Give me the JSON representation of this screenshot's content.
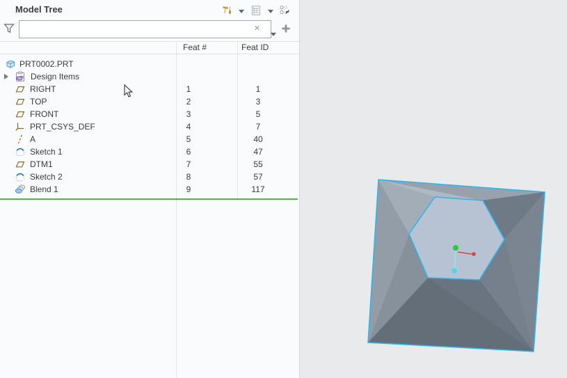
{
  "panel": {
    "title": "Model Tree",
    "toolbar_icons": [
      "tools-icon",
      "dropdown-arrow",
      "tree-settings-icon",
      "dropdown-arrow",
      "show-hide-tree-items-icon"
    ]
  },
  "filter": {
    "value": "",
    "placeholder": "",
    "clear_glyph": "×",
    "icons": [
      "filter-funnel-icon",
      "dropdown-arrow",
      "add-filter-plus-icon"
    ]
  },
  "columns": {
    "feat_number": "Feat #",
    "feat_id": "Feat ID"
  },
  "tree": {
    "rows": [
      {
        "label": "PRT0002.PRT",
        "icon": "part-icon",
        "feat_number": "",
        "feat_id": ""
      },
      {
        "label": "Design Items",
        "icon": "design-items-icon",
        "feat_number": "",
        "feat_id": "",
        "expandable": true
      },
      {
        "label": "RIGHT",
        "icon": "datum-plane-icon",
        "feat_number": "1",
        "feat_id": "1"
      },
      {
        "label": "TOP",
        "icon": "datum-plane-icon",
        "feat_number": "2",
        "feat_id": "3"
      },
      {
        "label": "FRONT",
        "icon": "datum-plane-icon",
        "feat_number": "3",
        "feat_id": "5"
      },
      {
        "label": "PRT_CSYS_DEF",
        "icon": "csys-icon",
        "feat_number": "4",
        "feat_id": "7"
      },
      {
        "label": "A",
        "icon": "axis-icon",
        "feat_number": "5",
        "feat_id": "40"
      },
      {
        "label": "Sketch 1",
        "icon": "sketch-icon",
        "feat_number": "6",
        "feat_id": "47"
      },
      {
        "label": "DTM1",
        "icon": "datum-plane-icon",
        "feat_number": "7",
        "feat_id": "55"
      },
      {
        "label": "Sketch 2",
        "icon": "sketch-icon",
        "feat_number": "8",
        "feat_id": "57"
      },
      {
        "label": "Blend 1",
        "icon": "blend-icon",
        "feat_number": "9",
        "feat_id": "117"
      }
    ],
    "insertion_indicator": "insert-here-line"
  },
  "colors": {
    "selection_highlight": "#2ab5ee",
    "insertion_line_green": "#4db848",
    "hex_top_face": "#b7c3d3",
    "csys_green": "#2ec840",
    "csys_red": "#d6453a",
    "csys_cyan": "#3fdde8",
    "viewport_background": "#e9eaec",
    "panel_background": "#f9fbfc"
  }
}
